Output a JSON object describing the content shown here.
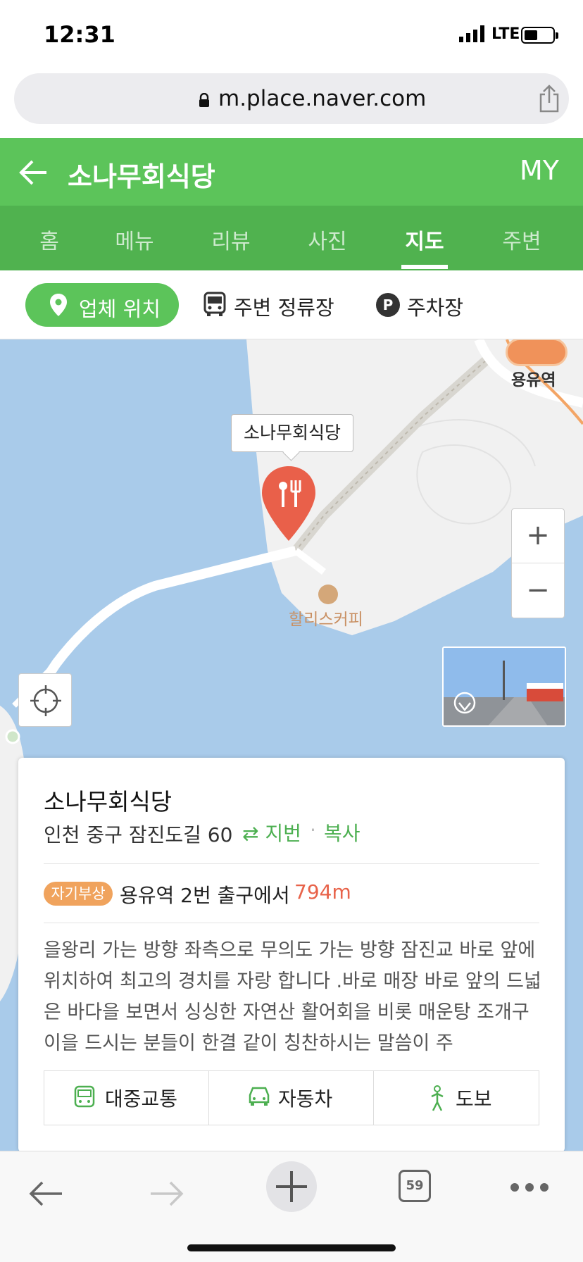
{
  "status": {
    "time": "12:31",
    "network": "LTE"
  },
  "browser": {
    "url": "m.place.naver.com"
  },
  "header": {
    "title": "소나무회식당",
    "my_label": "MY"
  },
  "tabs": [
    {
      "label": "홈"
    },
    {
      "label": "메뉴"
    },
    {
      "label": "리뷰"
    },
    {
      "label": "사진"
    },
    {
      "label": "지도",
      "active": true
    },
    {
      "label": "주변"
    }
  ],
  "filters": {
    "location": "업체 위치",
    "stops": "주변 정류장",
    "parking_icon": "P",
    "parking": "주차장"
  },
  "map": {
    "pin_label": "소나무회식당",
    "cafe_label": "할리스커피",
    "station_label": "용유역",
    "zoom_in": "+",
    "zoom_out": "−"
  },
  "card": {
    "title": "소나무회식당",
    "address": "인천 중구 잠진도길 60",
    "jibeon": "⇄ 지번",
    "separator": "·",
    "copy": "복사",
    "badge": "자기부상",
    "station_text": "용유역 2번 출구에서",
    "distance": "794m",
    "description": "을왕리 가는 방향 좌측으로 무의도 가는 방향 잠진교 바로 앞에 위치하여 최고의 경치를 자랑 합니다 .바로 매장 바로 앞의 드넓은 바다을 보면서 싱싱한 자연산 활어회을 비롯 매운탕 조개구이을 드시는 분들이 한결 같이 칭찬하시는 말씀이 주",
    "transit": "대중교통",
    "car": "자동차",
    "walk": "도보"
  },
  "bottombar": {
    "tabs_count": "59"
  },
  "colors": {
    "brand_green": "#5cc45a",
    "distance_red": "#e8634a",
    "badge_orange": "#f0a35d"
  }
}
